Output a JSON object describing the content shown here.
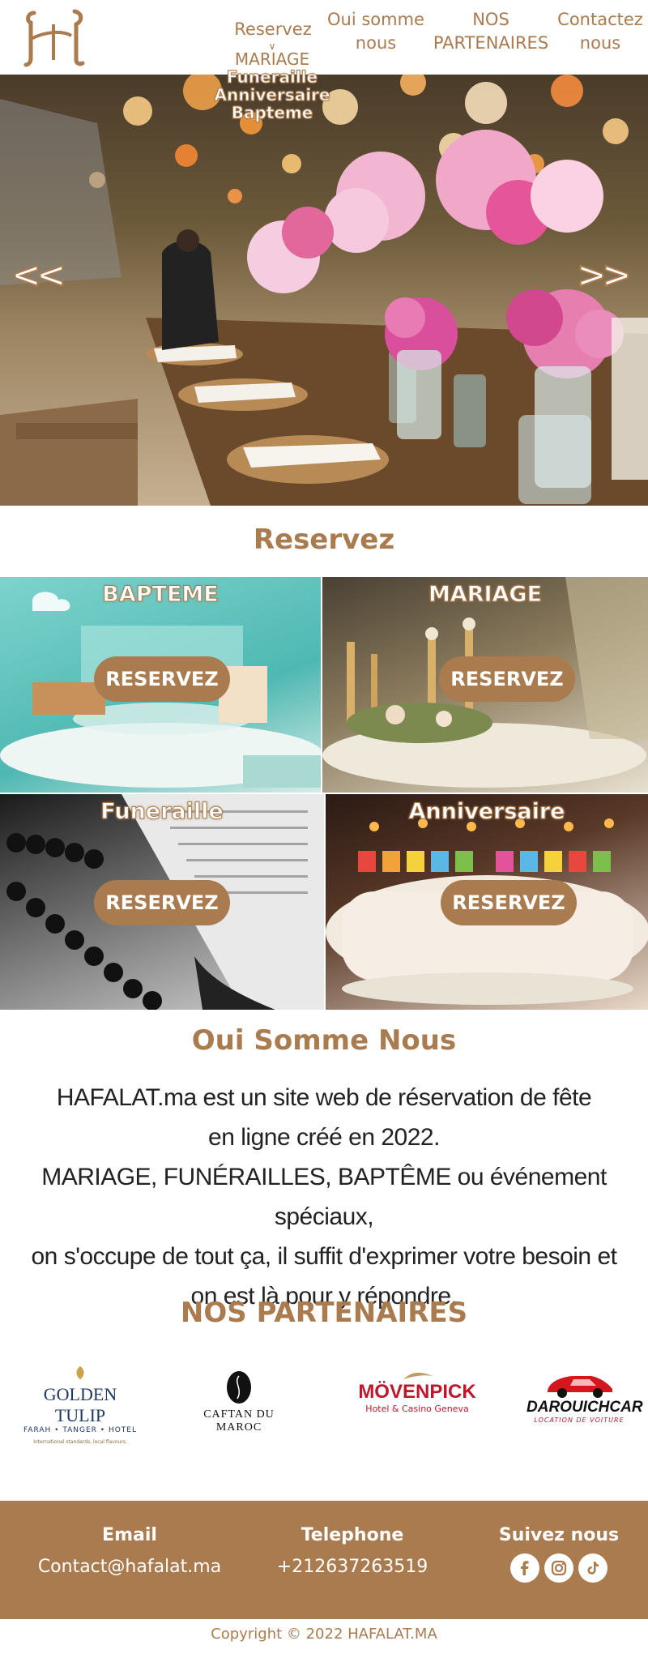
{
  "header": {
    "logo_text": "H",
    "nav": {
      "reserve": "Reservez",
      "about_line1": "Oui somme",
      "about_line2": "nous",
      "partners_line1": "NOS",
      "partners_line2": "PARTENAIRES",
      "contact_line1": "Contactez",
      "contact_line2": "nous"
    },
    "dropdown": {
      "chevron": "∨",
      "items": [
        "MARIAGE",
        "Funeraille",
        "Anniversaire",
        "Bapteme"
      ]
    }
  },
  "hero": {
    "prev_label": "<<",
    "next_label": ">>"
  },
  "reserve_section": {
    "title": "Reservez",
    "cards": [
      {
        "title": "BAPTEME",
        "button": "RESERVEZ"
      },
      {
        "title": "MARIAGE",
        "button": "RESERVEZ"
      },
      {
        "title": "Funeraille",
        "button": "RESERVEZ"
      },
      {
        "title": "Anniversaire",
        "button": "RESERVEZ"
      }
    ]
  },
  "about": {
    "title": "Oui Somme Nous",
    "lines": [
      "HAFALAT.ma est un site web de réservation de fête",
      "en ligne créé en 2022.",
      "MARIAGE, FUNÉRAILLES, BAPTÊME ou événement spéciaux,",
      "on s'occupe de  tout ça, il suffit d'exprimer votre besoin et",
      "on est là pour y répondre."
    ]
  },
  "partners": {
    "title": "NOS PARTENAIRES",
    "items": [
      {
        "name": "GOLDEN TULIP",
        "sub": "FARAH • TANGER • HOTEL",
        "tag": "International standards, local flavours."
      },
      {
        "name": "CAFTAN DU MAROC",
        "sub": ""
      },
      {
        "name": "MÖVENPICK",
        "sub": "Hotel & Casino Geneva"
      },
      {
        "name": "DAROUICHCAR",
        "sub": "LOCATION DE VOITURE"
      }
    ]
  },
  "footer": {
    "email_label": "Email",
    "email_value": "Contact@hafalat.ma",
    "phone_label": "Telephone",
    "phone_value": "+212637263519",
    "social_label": "Suivez nous",
    "social_icons": [
      "facebook-icon",
      "instagram-icon",
      "tiktok-icon"
    ]
  },
  "copyright": "Copyright © 2022 HAFALAT.MA",
  "colors": {
    "brand": "#a97b4f",
    "white": "#ffffff"
  }
}
